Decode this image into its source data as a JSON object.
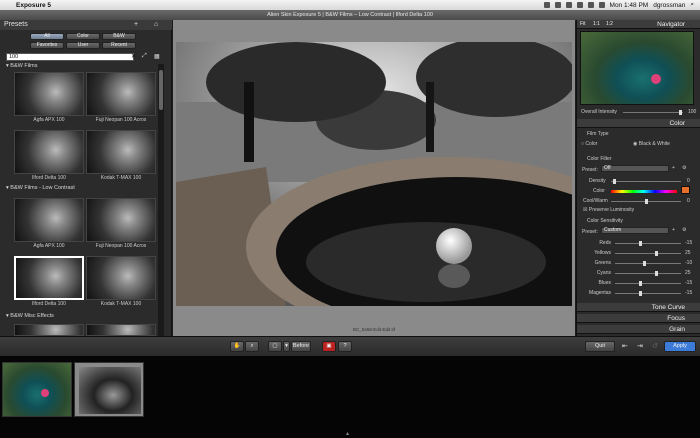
{
  "menubar": {
    "app_name": "Exposure 5",
    "user": "dgrossman",
    "clock": "Mon 1:48 PM"
  },
  "window": {
    "title": "Alien Skin Exposure 5 | B&W Films – Low Contrast | Ilford Delta 100"
  },
  "presets": {
    "title": "Presets",
    "tabs": [
      "All",
      "Color",
      "B&W",
      "Favorites",
      "User",
      "Recent"
    ],
    "selected_tab": "All",
    "search_value": "100",
    "sections": [
      {
        "name": "B&W Films",
        "items": [
          "Agfa APX 100",
          "Fuji Neopan 100 Acros",
          "Ilford Delta 100",
          "Kodak T-MAX 100"
        ]
      },
      {
        "name": "B&W Films - Low Contrast",
        "items": [
          "Agfa APX 100",
          "Fuji Neopan 100 Acros",
          "Ilford Delta 100",
          "Kodak T-MAX 100"
        ],
        "selected_index": 2
      },
      {
        "name": "B&W Misc Effects",
        "items": []
      }
    ]
  },
  "image": {
    "filename": "BC_5468-Edit-Edit.tif"
  },
  "navigator": {
    "title": "Navigator",
    "zoom_labels": [
      "Fit",
      "1:1",
      "1:2"
    ]
  },
  "overall": {
    "label": "Overall Intensity",
    "value": "100"
  },
  "color_panel": {
    "title": "Color",
    "film_type_label": "Film Type",
    "film_type_options": [
      "Color",
      "Black & White"
    ],
    "film_type_selected": "Black & White",
    "color_filter_label": "Color Filter",
    "preset_label": "Preset:",
    "preset_value": "Off",
    "density_label": "Density",
    "density_value": "0",
    "color_label": "Color",
    "cool_warm_label": "Cool/Warm",
    "cool_warm_value": "0",
    "preserve_luminosity": "Preserve Luminosity",
    "filter_swatch": "#e8702a"
  },
  "sensitivity": {
    "title": "Color Sensitivity",
    "preset_label": "Preset:",
    "preset_value": "Custom",
    "rows": [
      {
        "label": "Reds",
        "value": "-15"
      },
      {
        "label": "Yellows",
        "value": "25"
      },
      {
        "label": "Greens",
        "value": "-10"
      },
      {
        "label": "Cyans",
        "value": "25"
      },
      {
        "label": "Blues",
        "value": "-15"
      },
      {
        "label": "Magentas",
        "value": "-15"
      }
    ]
  },
  "collapsed_panels": [
    "Tone Curve",
    "Focus",
    "Grain"
  ],
  "toolbar": {
    "before_label": "Before",
    "quit_label": "Quit",
    "apply_label": "Apply",
    "accent": "#3d7bd9"
  }
}
